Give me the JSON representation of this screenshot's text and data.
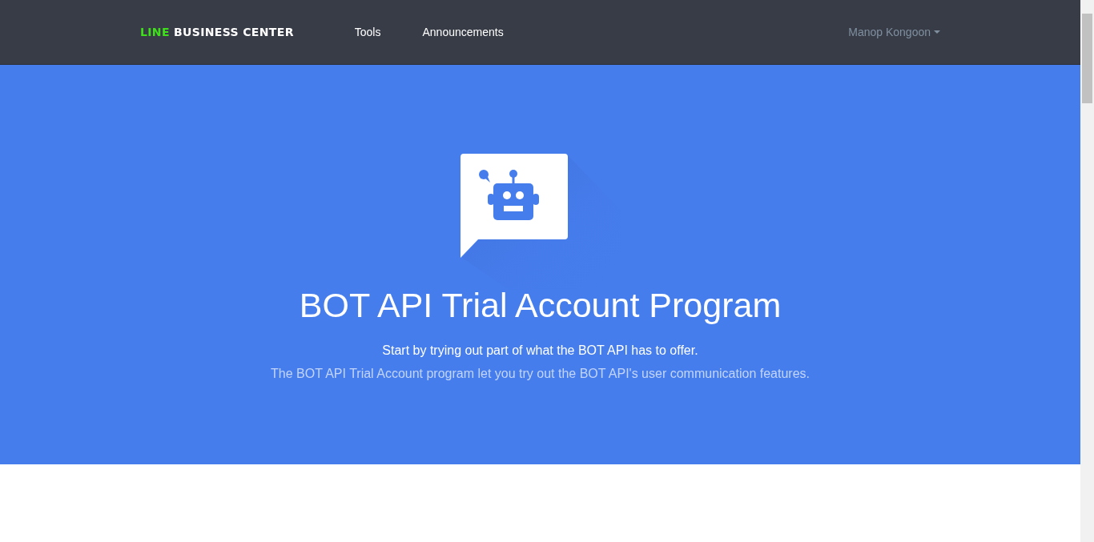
{
  "header": {
    "logo": {
      "brand": "LINE",
      "product": "BUSINESS CENTER"
    },
    "nav": [
      "Tools",
      "Announcements"
    ],
    "user_menu": "Manop Kongoon"
  },
  "hero": {
    "title": "BOT API Trial Account Program",
    "subtitle": "Start by trying out part of what the BOT API has to offer.",
    "description": "The BOT API Trial Account program let you try out the BOT API's user communication features."
  }
}
